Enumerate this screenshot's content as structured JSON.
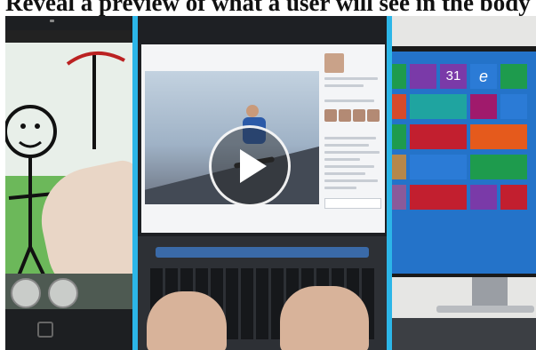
{
  "caption": "Reveal a preview of what a user will see in the body",
  "video": {
    "play_label": "Play video",
    "play_icon": "play-triangle-icon",
    "accent_color": "#2cb6e8"
  },
  "screens": {
    "tablet": {
      "content": "stick-figure-drawing"
    },
    "laptop": {
      "content": "skateboarder-video"
    },
    "desktop": {
      "content": "start-screen-tiles",
      "tile_number": "31"
    }
  }
}
